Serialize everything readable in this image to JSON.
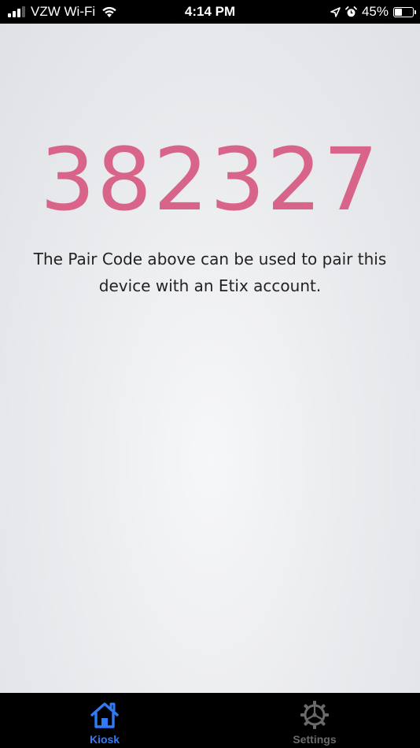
{
  "status_bar": {
    "carrier": "VZW Wi-Fi",
    "time": "4:14 PM",
    "battery_percent": "45%",
    "battery_level": 0.45,
    "icons": [
      "signal-icon",
      "wifi-icon",
      "location-icon",
      "alarm-icon",
      "battery-icon"
    ]
  },
  "main": {
    "pair_code": "382327",
    "description": "The Pair Code above can be used to pair this device with an Etix account."
  },
  "tab_bar": {
    "tabs": [
      {
        "label": "Kiosk",
        "icon": "home-icon",
        "active": true
      },
      {
        "label": "Settings",
        "icon": "gear-icon",
        "active": false
      }
    ]
  },
  "colors": {
    "pair_code": "#d9648a",
    "active_tab": "#2f7bf5",
    "inactive_tab": "#6a6a6a"
  }
}
